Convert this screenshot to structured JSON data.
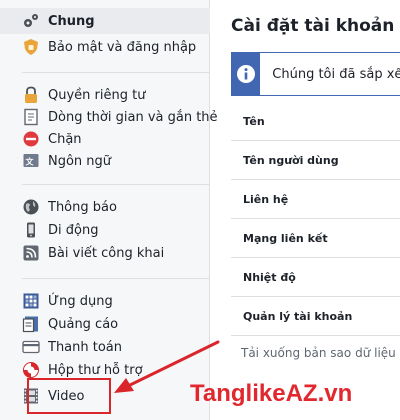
{
  "sidebar": {
    "items": [
      {
        "label": "Chung",
        "icon": "gear-icon"
      },
      {
        "label": "Bảo mật và đăng nhập",
        "icon": "shield-icon"
      },
      {
        "label": "Quyền riêng tư",
        "icon": "lock-icon"
      },
      {
        "label": "Dòng thời gian và gắn thẻ",
        "icon": "timeline-icon"
      },
      {
        "label": "Chặn",
        "icon": "block-icon"
      },
      {
        "label": "Ngôn ngữ",
        "icon": "language-icon"
      },
      {
        "label": "Thông báo",
        "icon": "globe-icon"
      },
      {
        "label": "Di động",
        "icon": "mobile-icon"
      },
      {
        "label": "Bài viết công khai",
        "icon": "rss-icon"
      },
      {
        "label": "Ứng dụng",
        "icon": "apps-icon"
      },
      {
        "label": "Quảng cáo",
        "icon": "ads-icon"
      },
      {
        "label": "Thanh toán",
        "icon": "card-icon"
      },
      {
        "label": "Hộp thư hỗ trợ",
        "icon": "lifebuoy-icon"
      },
      {
        "label": "Video",
        "icon": "film-icon"
      }
    ]
  },
  "main": {
    "title": "Cài đặt tài khoản chung",
    "notice": "Chúng tôi đã sắp xếp lại",
    "rows": [
      "Tên",
      "Tên người dùng",
      "Liên hệ",
      "Mạng liên kết",
      "Nhiệt độ",
      "Quản lý tài khoản"
    ],
    "download": "Tải xuống bản sao dữ liệu Facebook"
  },
  "watermark": "TanglikeAZ.vn",
  "colors": {
    "accent": "#4267b2",
    "annotation": "#d9262b"
  }
}
